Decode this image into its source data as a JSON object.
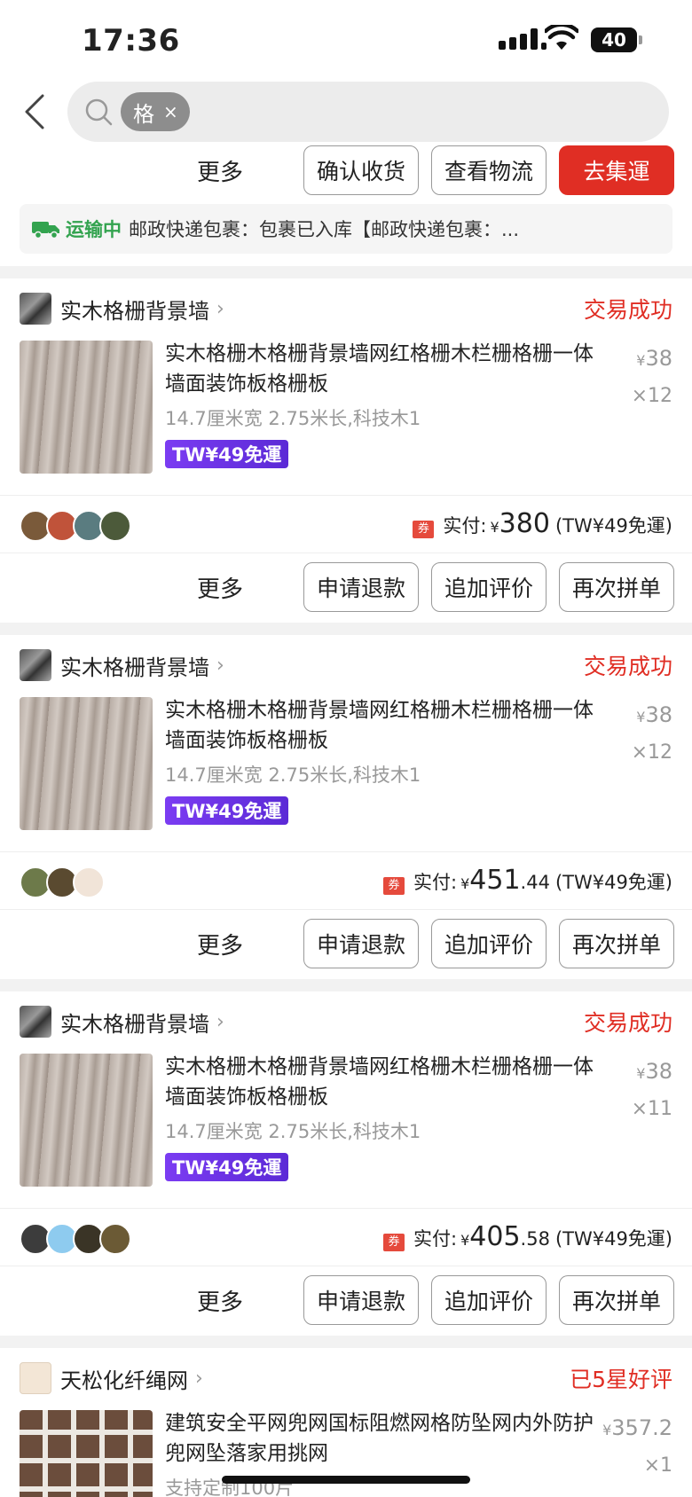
{
  "status_bar": {
    "time": "17:36",
    "battery": "40"
  },
  "search": {
    "chip": "格",
    "chip_close": "×"
  },
  "top_actions": {
    "more": "更多",
    "confirm": "确认收货",
    "logistics": "查看物流",
    "consolidate": "去集運"
  },
  "logistics_bar": {
    "status": "运输中",
    "message": "邮政快递包裹：包裹已入库【邮政快递包裹：..."
  },
  "orders": [
    {
      "shop": "实木格栅背景墙",
      "status": "交易成功",
      "title": "实木格栅木格栅背景墙网红格栅木栏栅格栅一体墙面装饰板格栅板",
      "spec": "14.7厘米宽 2.75米长,科技木1",
      "tag": "TW¥49免運",
      "price_symbol": "¥",
      "price": "38",
      "qty": "×12",
      "paid_label": "实付:",
      "paid_symbol": "¥",
      "paid_int": "380",
      "paid_dec": "",
      "shipping": "(TW¥49免運)",
      "actions": {
        "more": "更多",
        "refund": "申请退款",
        "review": "追加评价",
        "rebuy": "再次拼单"
      }
    },
    {
      "shop": "实木格栅背景墙",
      "status": "交易成功",
      "title": "实木格栅木格栅背景墙网红格栅木栏栅格栅一体墙面装饰板格栅板",
      "spec": "14.7厘米宽 2.75米长,科技木1",
      "tag": "TW¥49免運",
      "price_symbol": "¥",
      "price": "38",
      "qty": "×12",
      "paid_label": "实付:",
      "paid_symbol": "¥",
      "paid_int": "451",
      "paid_dec": ".44",
      "shipping": "(TW¥49免運)",
      "actions": {
        "more": "更多",
        "refund": "申请退款",
        "review": "追加评价",
        "rebuy": "再次拼单"
      }
    },
    {
      "shop": "实木格栅背景墙",
      "status": "交易成功",
      "title": "实木格栅木格栅背景墙网红格栅木栏栅格栅一体墙面装饰板格栅板",
      "spec": "14.7厘米宽 2.75米长,科技木1",
      "tag": "TW¥49免運",
      "price_symbol": "¥",
      "price": "38",
      "qty": "×11",
      "paid_label": "实付:",
      "paid_symbol": "¥",
      "paid_int": "405",
      "paid_dec": ".58",
      "shipping": "(TW¥49免運)",
      "actions": {
        "more": "更多",
        "refund": "申请退款",
        "review": "追加评价",
        "rebuy": "再次拼单"
      }
    },
    {
      "shop": "天松化纤绳网",
      "status": "已5星好评",
      "title": "建筑安全平网兜网国标阻燃网格防坠网内外防护兜网坠落家用挑网",
      "spec": "支持定制100片",
      "price_symbol": "¥",
      "price": "357.2",
      "qty": "×1"
    }
  ],
  "colors": {
    "accent_red": "#e02e24",
    "transit_green": "#33a34f",
    "tag_purple": "#6a33e6"
  }
}
